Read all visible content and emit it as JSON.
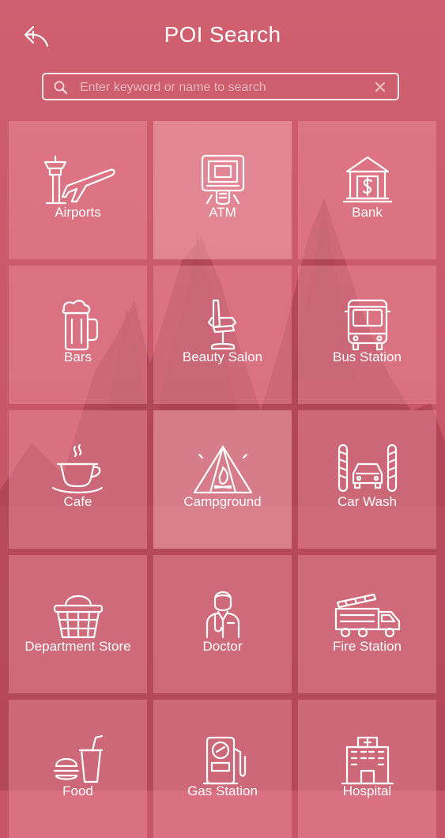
{
  "header": {
    "title": "POI Search"
  },
  "search": {
    "placeholder": "Enter keyword or name to search",
    "value": ""
  },
  "categories": [
    {
      "label": "Airports",
      "icon": "airport-icon"
    },
    {
      "label": "ATM",
      "icon": "atm-icon"
    },
    {
      "label": "Bank",
      "icon": "bank-icon"
    },
    {
      "label": "Bars",
      "icon": "beer-mug-icon"
    },
    {
      "label": "Beauty Salon",
      "icon": "salon-chair-icon"
    },
    {
      "label": "Bus Station",
      "icon": "bus-icon"
    },
    {
      "label": "Cafe",
      "icon": "coffee-cup-icon"
    },
    {
      "label": "Campground",
      "icon": "tent-icon"
    },
    {
      "label": "Car Wash",
      "icon": "car-wash-icon"
    },
    {
      "label": "Department Store",
      "icon": "basket-icon"
    },
    {
      "label": "Doctor",
      "icon": "doctor-icon"
    },
    {
      "label": "Fire Station",
      "icon": "fire-truck-icon"
    },
    {
      "label": "Food",
      "icon": "burger-drink-icon"
    },
    {
      "label": "Gas Station",
      "icon": "gas-pump-icon"
    },
    {
      "label": "Hospital",
      "icon": "hospital-icon"
    }
  ],
  "colors": {
    "background": "#c8566a",
    "tile": "#ef96a5",
    "text": "#ffffff"
  }
}
